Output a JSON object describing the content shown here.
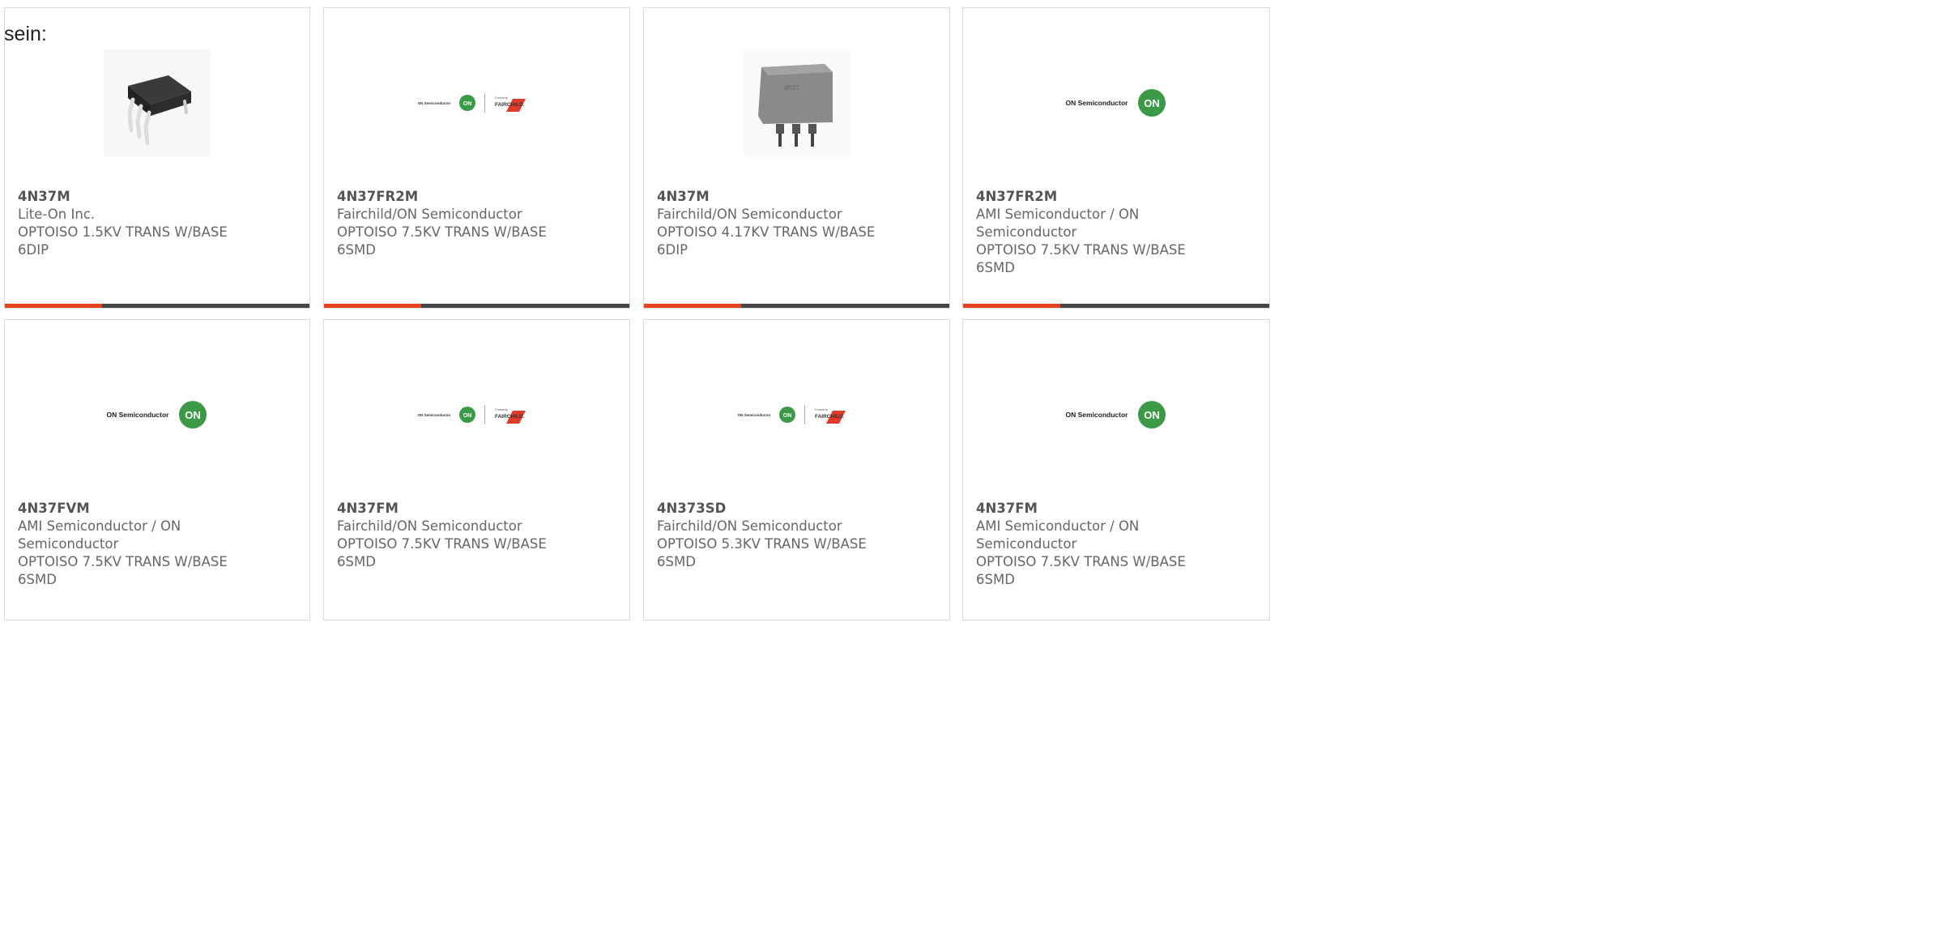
{
  "intro_text": "sein:",
  "products": [
    {
      "part": "4N37M",
      "maker": "Lite-On Inc.",
      "desc": "OPTOISO 1.5KV TRANS W/BASE",
      "pkg": "6DIP",
      "image": "dip-black-chip"
    },
    {
      "part": "4N37FR2M",
      "maker": "Fairchild/ON Semiconductor",
      "desc": "OPTOISO 7.5KV TRANS W/BASE",
      "pkg": "6SMD",
      "image": "on-fairchild-logo"
    },
    {
      "part": "4N37M",
      "maker": "Fairchild/ON Semiconductor",
      "desc": "OPTOISO 4.17KV TRANS W/BASE",
      "pkg": "6DIP",
      "image": "dip-gray-chip"
    },
    {
      "part": "4N37FR2M",
      "maker": "AMI Semiconductor / ON Semiconductor",
      "desc": "OPTOISO 7.5KV TRANS W/BASE",
      "pkg": "6SMD",
      "image": "on-semiconductor-logo"
    },
    {
      "part": "4N37FVM",
      "maker": "AMI Semiconductor / ON Semiconductor",
      "desc": "OPTOISO 7.5KV TRANS W/BASE",
      "pkg": "6SMD",
      "image": "on-semiconductor-logo"
    },
    {
      "part": "4N37FM",
      "maker": "Fairchild/ON Semiconductor",
      "desc": "OPTOISO 7.5KV TRANS W/BASE",
      "pkg": "6SMD",
      "image": "on-fairchild-logo"
    },
    {
      "part": "4N373SD",
      "maker": "Fairchild/ON Semiconductor",
      "desc": "OPTOISO 5.3KV TRANS W/BASE",
      "pkg": "6SMD",
      "image": "on-fairchild-logo"
    },
    {
      "part": "4N37FM",
      "maker": "AMI Semiconductor / ON Semiconductor",
      "desc": "OPTOISO 7.5KV TRANS W/BASE",
      "pkg": "6SMD",
      "image": "on-semiconductor-logo"
    }
  ],
  "logo_text": {
    "on_semi": "ON Semiconductor",
    "on_badge": "ON",
    "formerly": "Formerly",
    "fairchild": "FAIRCHILD.",
    "chip_marking": "4N37"
  },
  "colors": {
    "accent": "#e8421c",
    "bar": "#454545",
    "on_green": "#3a9a45",
    "fairchild_red": "#e03a2a"
  }
}
